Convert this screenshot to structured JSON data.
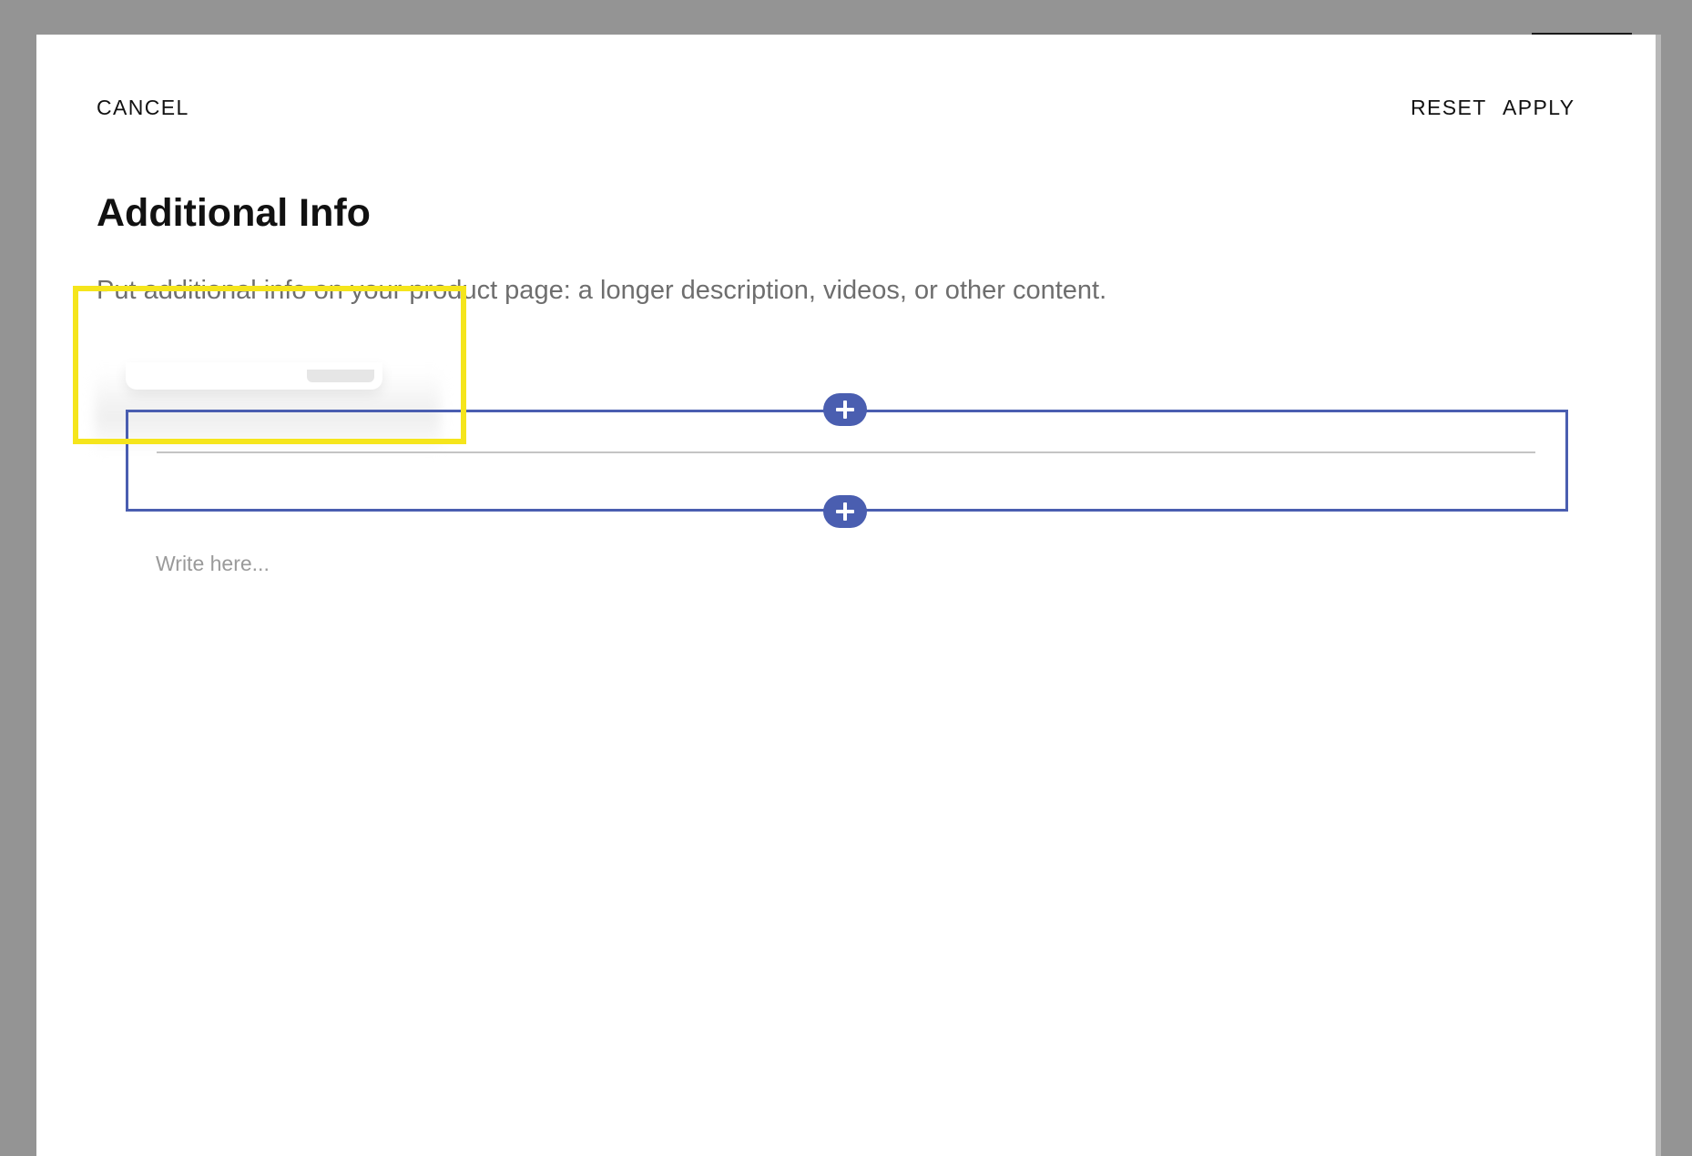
{
  "header": {
    "cancel_label": "CANCEL",
    "reset_label": "RESET",
    "apply_label": "APPLY"
  },
  "content": {
    "title": "Additional Info",
    "description": "Put additional info on your product page: a longer description, videos, or other content.",
    "editor_placeholder": "Write here..."
  },
  "icons": {
    "add_block_top": "plus-icon",
    "add_block_bottom": "plus-icon"
  },
  "colors": {
    "accent": "#4a5eb0",
    "highlight": "#f5e51c",
    "backdrop": "#949494",
    "text_primary": "#111111",
    "text_secondary": "#6e6e6e",
    "placeholder": "#9a9a9a"
  }
}
